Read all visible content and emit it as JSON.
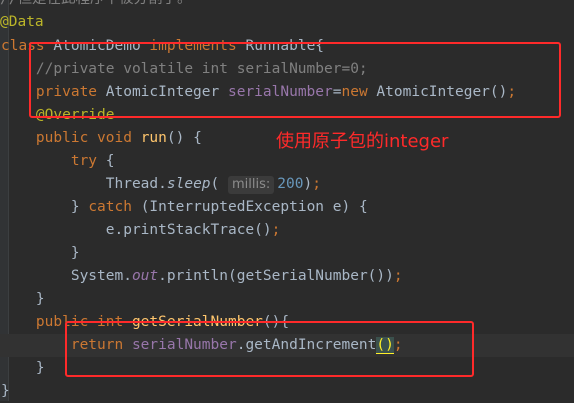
{
  "editor": {
    "lines": [
      {
        "id": "l0",
        "tokens": [
          {
            "t": "//但是在此程序中被分割了。",
            "c": "cm"
          }
        ]
      },
      {
        "id": "l1",
        "tokens": [
          {
            "t": "@Data",
            "c": "ann"
          }
        ]
      },
      {
        "id": "l2",
        "tokens": [
          {
            "t": "class",
            "c": "k"
          },
          {
            "t": " AtomicDemo ",
            "c": ""
          },
          {
            "t": "implements",
            "c": "k"
          },
          {
            "t": " Runnable{",
            "c": ""
          }
        ]
      },
      {
        "id": "l3",
        "tokens": [
          {
            "t": "    //private volatile int serialNumber=0;",
            "c": "cm"
          }
        ]
      },
      {
        "id": "l4",
        "tokens": [
          {
            "t": "    private",
            "c": "k"
          },
          {
            "t": " AtomicInteger ",
            "c": ""
          },
          {
            "t": "serialNumber",
            "c": "fld"
          },
          {
            "t": "=",
            "c": ""
          },
          {
            "t": "new",
            "c": "k"
          },
          {
            "t": " AtomicInteger()",
            "c": ""
          },
          {
            "t": ";",
            "c": "k"
          }
        ]
      },
      {
        "id": "l5",
        "tokens": [
          {
            "t": "    @Override",
            "c": "ann"
          }
        ]
      },
      {
        "id": "l6",
        "tokens": [
          {
            "t": "    public void",
            "c": "k"
          },
          {
            "t": " ",
            "c": ""
          },
          {
            "t": "run",
            "c": "meth"
          },
          {
            "t": "() {",
            "c": ""
          }
        ]
      },
      {
        "id": "l7",
        "tokens": [
          {
            "t": "        try",
            "c": "k"
          },
          {
            "t": " {",
            "c": ""
          }
        ]
      },
      {
        "id": "l8",
        "tokens": [
          {
            "t": "            Thread.",
            "c": ""
          },
          {
            "t": "sleep",
            "c": "it"
          },
          {
            "t": "( ",
            "c": ""
          },
          {
            "t": "millis:",
            "c": "hint"
          },
          {
            "t": "200",
            "c": "num"
          },
          {
            "t": ")",
            "c": ""
          },
          {
            "t": ";",
            "c": "k"
          }
        ]
      },
      {
        "id": "l9",
        "tokens": [
          {
            "t": "        } ",
            "c": ""
          },
          {
            "t": "catch",
            "c": "k"
          },
          {
            "t": " (InterruptedException e) {",
            "c": ""
          }
        ]
      },
      {
        "id": "l10",
        "tokens": [
          {
            "t": "            e.printStackTrace()",
            "c": ""
          },
          {
            "t": ";",
            "c": "k"
          }
        ]
      },
      {
        "id": "l11",
        "tokens": [
          {
            "t": "        }",
            "c": ""
          }
        ]
      },
      {
        "id": "l12",
        "tokens": [
          {
            "t": "        System.",
            "c": ""
          },
          {
            "t": "out",
            "c": "fld it"
          },
          {
            "t": ".println(getSerialNumber())",
            "c": ""
          },
          {
            "t": ";",
            "c": "k"
          }
        ]
      },
      {
        "id": "l13",
        "tokens": [
          {
            "t": "    }",
            "c": ""
          }
        ]
      },
      {
        "id": "l14",
        "tokens": [
          {
            "t": "    public int",
            "c": "k"
          },
          {
            "t": " ",
            "c": ""
          },
          {
            "t": "getSerialNumber",
            "c": "meth"
          },
          {
            "t": "(){",
            "c": ""
          }
        ]
      },
      {
        "id": "l15",
        "tokens": [
          {
            "t": "        return",
            "c": "k"
          },
          {
            "t": " ",
            "c": ""
          },
          {
            "t": "serialNumber",
            "c": "fld"
          },
          {
            "t": ".getAndIncrement",
            "c": ""
          },
          {
            "t": "()",
            "c": "paren-match"
          },
          {
            "t": ";",
            "c": "k"
          }
        ]
      },
      {
        "id": "l16",
        "tokens": [
          {
            "t": "    }",
            "c": ""
          }
        ]
      },
      {
        "id": "l17",
        "tokens": [
          {
            "t": "}",
            "c": ""
          }
        ]
      }
    ]
  },
  "annotation": {
    "note": "使用原子包的integer",
    "color": "#ff2a2a"
  },
  "colors": {
    "background": "#2b2b2b",
    "keyword": "#cc7832",
    "annotation": "#bbb529",
    "comment": "#808080",
    "field": "#9876aa",
    "method": "#ffc66d",
    "number": "#6897bb"
  }
}
